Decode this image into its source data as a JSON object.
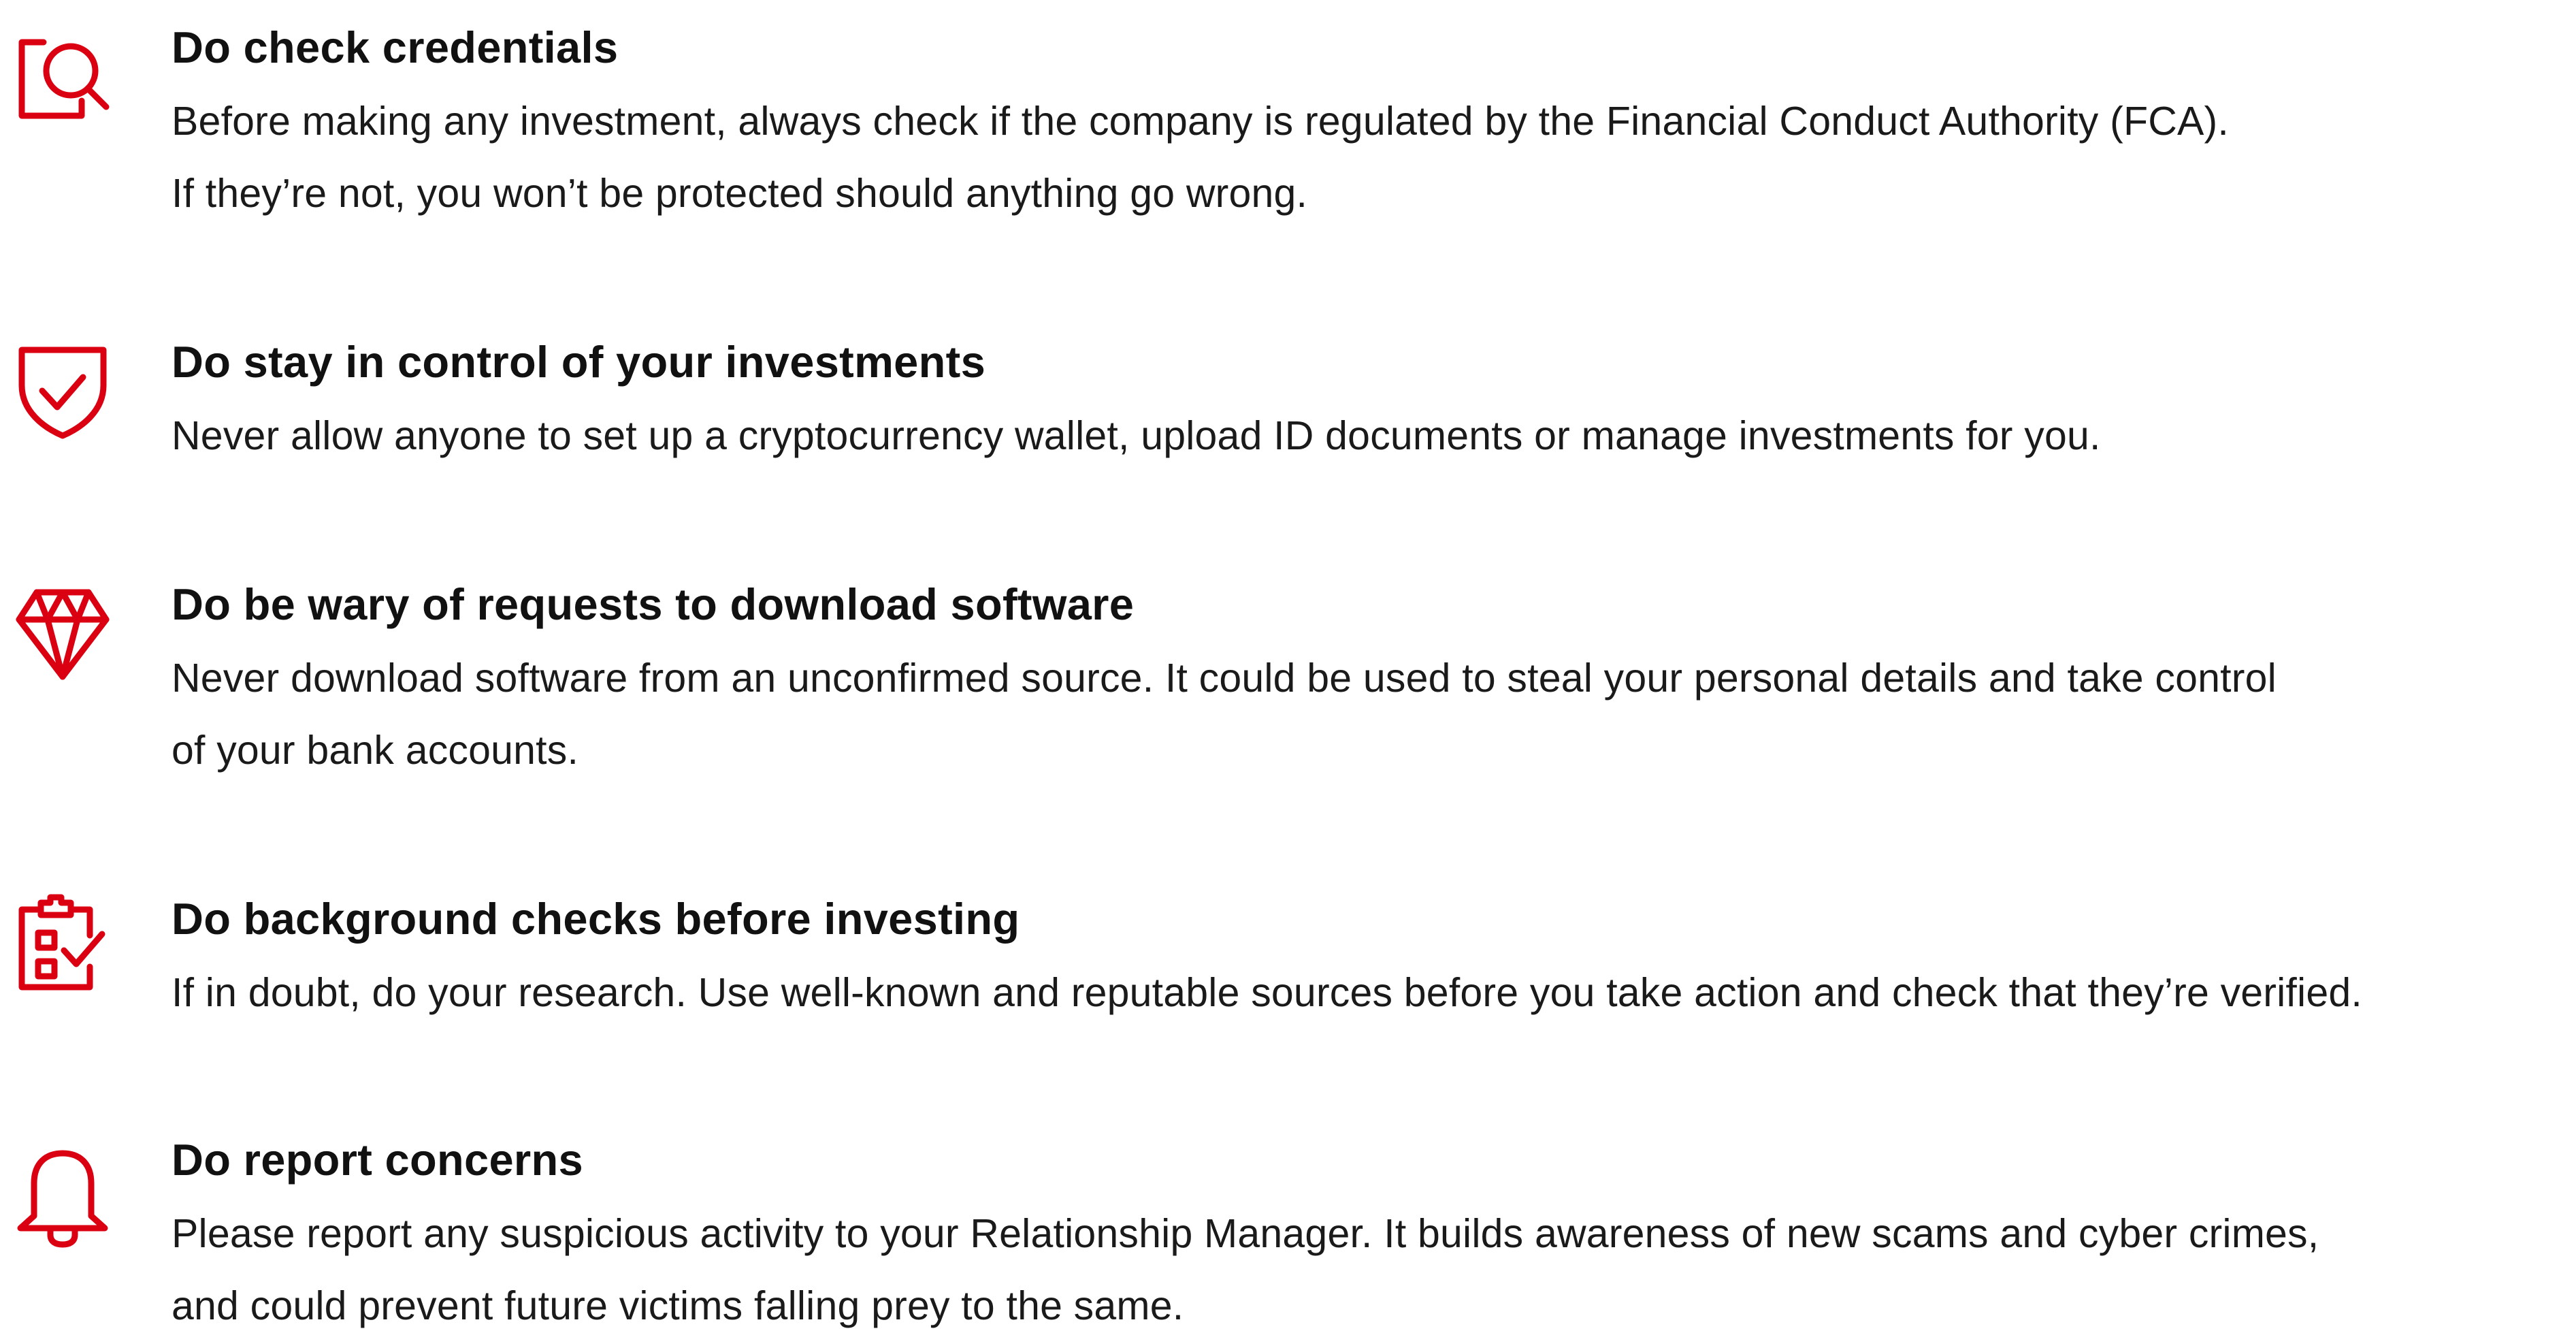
{
  "items": [
    {
      "icon": "search-document-icon",
      "heading": "Do check credentials",
      "lines": [
        "Before making any investment, always check if the company is regulated by the Financial Conduct Authority (FCA).",
        "If they’re not, you won’t be protected should anything go wrong."
      ]
    },
    {
      "icon": "shield-check-icon",
      "heading": "Do stay in control of your investments",
      "lines": [
        "Never allow anyone to set up a cryptocurrency wallet, upload ID documents or manage investments for you."
      ]
    },
    {
      "icon": "diamond-icon",
      "heading": "Do be wary of requests to download software",
      "lines": [
        "Never download software from an unconfirmed source. It could be used to steal your personal details and take control",
        "of your bank accounts."
      ]
    },
    {
      "icon": "clipboard-checklist-icon",
      "heading": "Do background checks before investing",
      "lines": [
        "If in doubt, do your research. Use well-known and reputable sources before you take action and check that they’re verified."
      ]
    },
    {
      "icon": "bell-icon",
      "heading": "Do report concerns",
      "lines": [
        "Please report any suspicious activity to your Relationship Manager. It builds awareness of new scams and cyber crimes,",
        "and could prevent future victims falling prey to the same."
      ]
    }
  ]
}
